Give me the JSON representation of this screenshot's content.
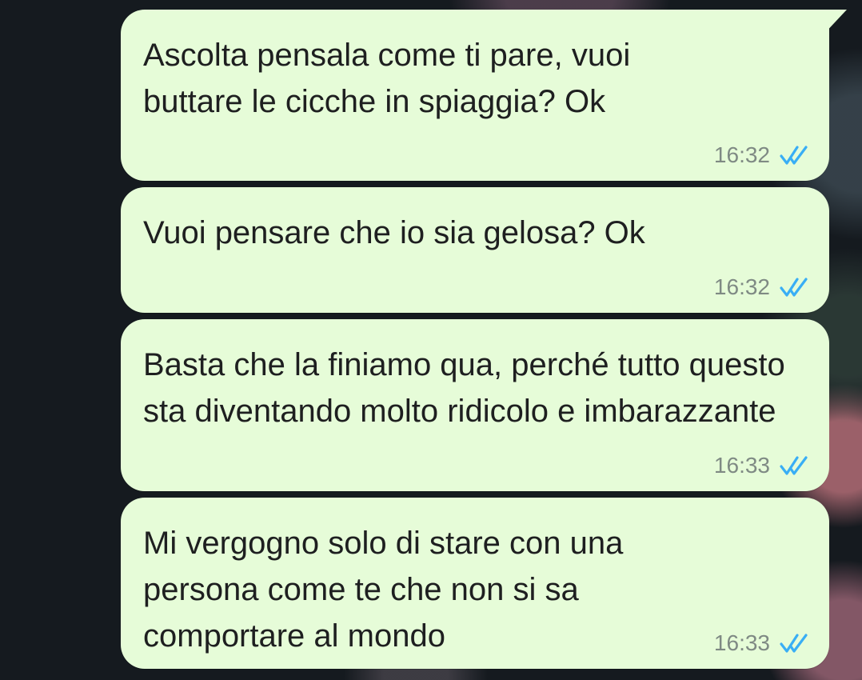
{
  "chat": {
    "messages": [
      {
        "text": "Ascolta pensala come ti pare, vuoi buttare le cicche in spiaggia? Ok",
        "time": "16:32",
        "status_icon": "double-check-read-icon"
      },
      {
        "text": "Vuoi pensare che io sia gelosa? Ok",
        "time": "16:32",
        "status_icon": "double-check-read-icon"
      },
      {
        "text": "Basta che la finiamo qua, perché tutto questo sta diventando molto ridicolo e imbarazzante",
        "time": "16:33",
        "status_icon": "double-check-read-icon"
      },
      {
        "text": "Mi vergogno solo di stare con una persona come te che non si sa comportare al mondo",
        "time": "16:33",
        "status_icon": "double-check-read-icon"
      }
    ]
  },
  "colors": {
    "bubble_background": "#e6fcd8",
    "read_check": "#39aef5",
    "timestamp": "#7f8a84",
    "chat_background": "#151a1f"
  }
}
